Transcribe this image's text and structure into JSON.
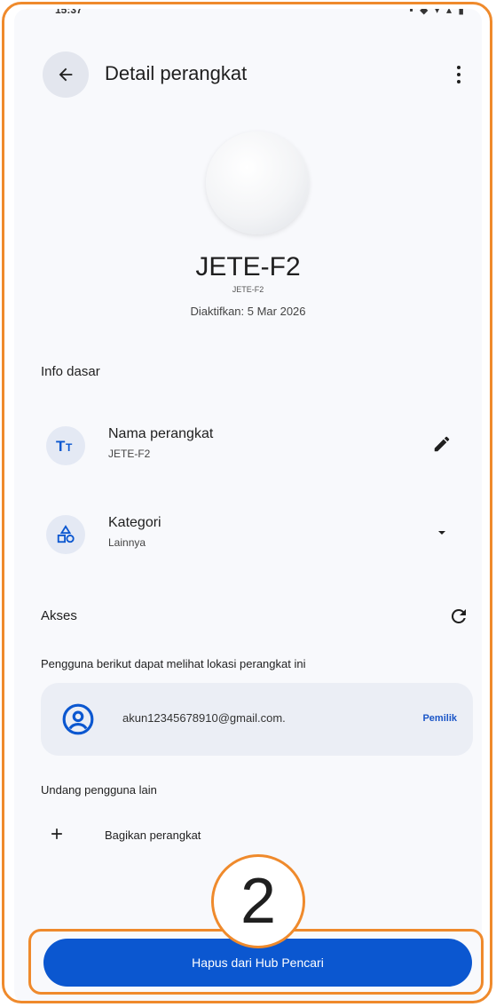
{
  "status_bar": {
    "time": "15:37",
    "icons": "▪ ◆ ▾ ▴ ▮"
  },
  "app_bar": {
    "back_icon": "arrow-left",
    "title": "Detail perangkat",
    "more_icon": "more-vert"
  },
  "device": {
    "name": "JETE-F2",
    "subtitle": "JETE-F2",
    "activated": "Diaktifkan: 5 Mar 2026"
  },
  "basic_info": {
    "section_title": "Info dasar",
    "name_row": {
      "icon": "text-fields",
      "title": "Nama perangkat",
      "value": "JETE-F2",
      "action_icon": "edit-pencil"
    },
    "category_row": {
      "icon": "category-shapes",
      "title": "Kategori",
      "value": "Lainnya",
      "action_icon": "dropdown-arrow"
    }
  },
  "access": {
    "section_title": "Akses",
    "refresh_icon": "refresh",
    "description": "Pengguna berikut dapat melihat lokasi perangkat ini",
    "user": {
      "icon": "account-circle",
      "email": "akun12345678910@gmail.com.",
      "role": "Pemilik"
    },
    "invite_label": "Undang pengguna lain",
    "share": {
      "icon": "plus",
      "label": "Bagikan perangkat"
    }
  },
  "annotation": {
    "step_number": "2"
  },
  "footer": {
    "delete_label": "Hapus dari Hub Pencari"
  },
  "colors": {
    "accent_orange": "#ef8a2c",
    "primary_blue": "#0b57d0",
    "owner_blue": "#1a55c7",
    "card_bg": "#ebeef5"
  }
}
